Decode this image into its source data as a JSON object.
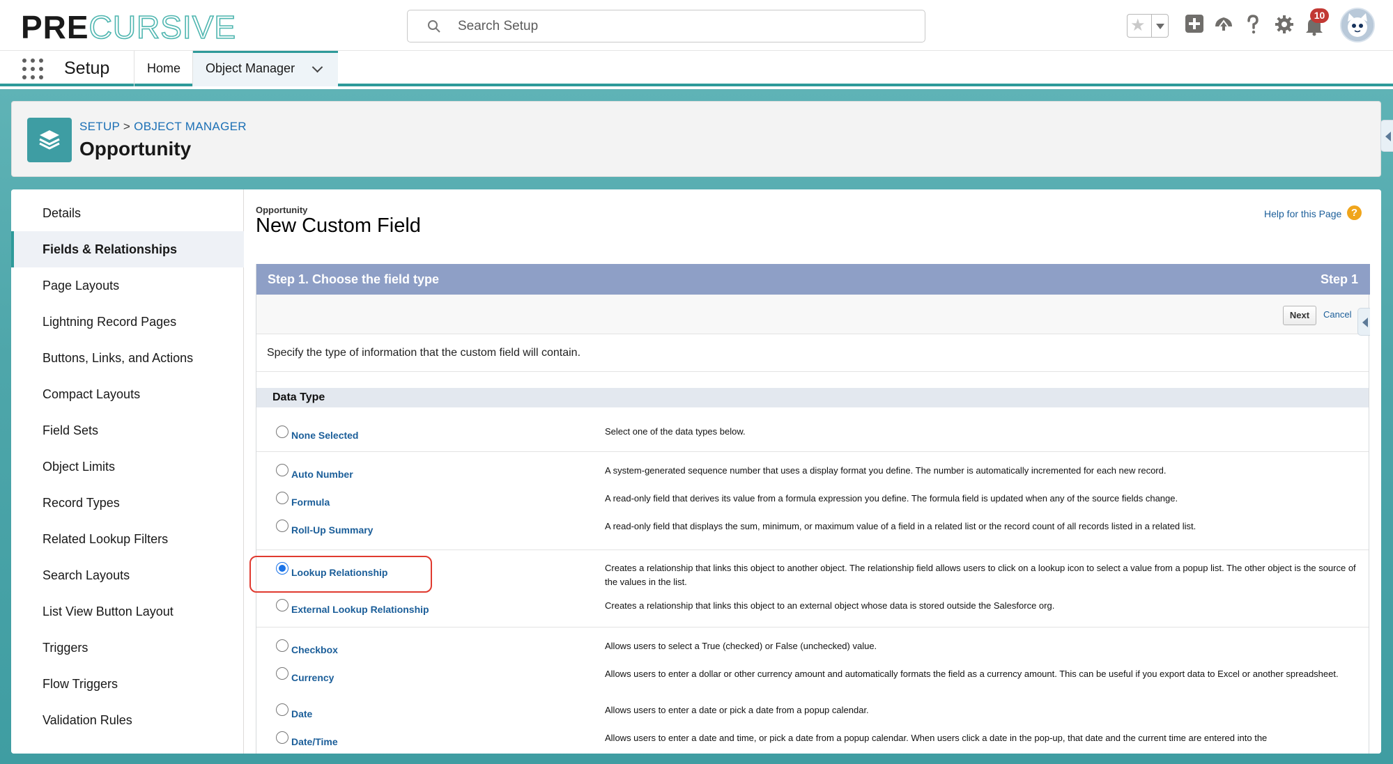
{
  "brand": {
    "logo_part1": "PRE",
    "logo_part2": "CURSIVE"
  },
  "search": {
    "placeholder": "Search Setup"
  },
  "header": {
    "notifications_count": "10"
  },
  "nav": {
    "app_name": "Setup",
    "tabs": [
      {
        "label": "Home"
      },
      {
        "label": "Object Manager"
      }
    ]
  },
  "object_header": {
    "breadcrumb": {
      "setup": "SETUP",
      "separator": ">",
      "object_manager": "OBJECT MANAGER"
    },
    "title": "Opportunity"
  },
  "sidebar": {
    "items": [
      {
        "label": "Details"
      },
      {
        "label": "Fields & Relationships"
      },
      {
        "label": "Page Layouts"
      },
      {
        "label": "Lightning Record Pages"
      },
      {
        "label": "Buttons, Links, and Actions"
      },
      {
        "label": "Compact Layouts"
      },
      {
        "label": "Field Sets"
      },
      {
        "label": "Object Limits"
      },
      {
        "label": "Record Types"
      },
      {
        "label": "Related Lookup Filters"
      },
      {
        "label": "Search Layouts"
      },
      {
        "label": "List View Button Layout"
      },
      {
        "label": "Triggers"
      },
      {
        "label": "Flow Triggers"
      },
      {
        "label": "Validation Rules"
      }
    ],
    "active_index": 1
  },
  "page": {
    "pre_title": "Opportunity",
    "title": "New Custom Field",
    "help_link": "Help for this Page",
    "help_icon": "?",
    "step_title": "Step 1. Choose the field type",
    "step_label": "Step 1",
    "next_button": "Next",
    "cancel_link": "Cancel",
    "intro": "Specify the type of information that the custom field will contain.",
    "data_type_header": "Data Type"
  },
  "data_types": [
    {
      "label": "None Selected",
      "description": "Select one of the data types below.",
      "selected": false
    },
    {
      "label": "Auto Number",
      "description": "A system-generated sequence number that uses a display format you define. The number is automatically incremented for each new record.",
      "selected": false
    },
    {
      "label": "Formula",
      "description": "A read-only field that derives its value from a formula expression you define. The formula field is updated when any of the source fields change.",
      "selected": false
    },
    {
      "label": "Roll-Up Summary",
      "description": "A read-only field that displays the sum, minimum, or maximum value of a field in a related list or the record count of all records listed in a related list.",
      "selected": false
    },
    {
      "label": "Lookup Relationship",
      "description": "Creates a relationship that links this object to another object. The relationship field allows users to click on a lookup icon to select a value from a popup list. The other object is the source of the values in the list.",
      "selected": true
    },
    {
      "label": "External Lookup Relationship",
      "description": "Creates a relationship that links this object to an external object whose data is stored outside the Salesforce org.",
      "selected": false
    },
    {
      "label": "Checkbox",
      "description": "Allows users to select a True (checked) or False (unchecked) value.",
      "selected": false
    },
    {
      "label": "Currency",
      "description": "Allows users to enter a dollar or other currency amount and automatically formats the field as a currency amount. This can be useful if you export data to Excel or another spreadsheet.",
      "selected": false
    },
    {
      "label": "Date",
      "description": "Allows users to enter a date or pick a date from a popup calendar.",
      "selected": false
    },
    {
      "label": "Date/Time",
      "description": "Allows users to enter a date and time, or pick a date from a popup calendar. When users click a date in the pop-up, that date and the current time are entered into the",
      "selected": false
    }
  ],
  "colors": {
    "accent_teal": "#2e9a9a",
    "step_bar": "#8e9fc6",
    "link_blue": "#1b5e99",
    "highlight_red": "#e03a2f",
    "notification_red": "#c23934"
  },
  "icons": [
    "search-icon",
    "star-icon",
    "add-icon",
    "trailhead-icon",
    "help-icon",
    "gear-icon",
    "bell-icon",
    "avatar",
    "app-launcher-icon",
    "chevron-down-icon",
    "object-layers-icon"
  ]
}
